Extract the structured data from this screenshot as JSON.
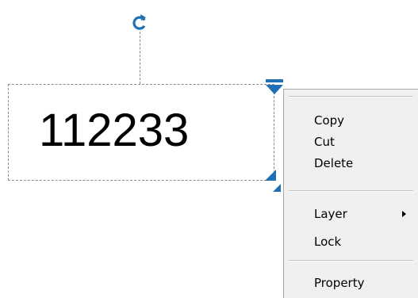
{
  "canvas": {
    "object_text": "112233",
    "accent_color": "#1f6fb5"
  },
  "context_menu": {
    "items": [
      {
        "label": "Copy"
      },
      {
        "label": "Cut"
      },
      {
        "label": "Delete"
      },
      {
        "label": "Layer",
        "has_submenu": true
      },
      {
        "label": "Lock"
      },
      {
        "label": "Property"
      }
    ]
  },
  "icons": {
    "rotate": "rotate-icon",
    "top_handle": "resize-handle-top-icon",
    "bottom_handle": "resize-handle-bottom-icon",
    "submenu": "chevron-right-icon"
  }
}
